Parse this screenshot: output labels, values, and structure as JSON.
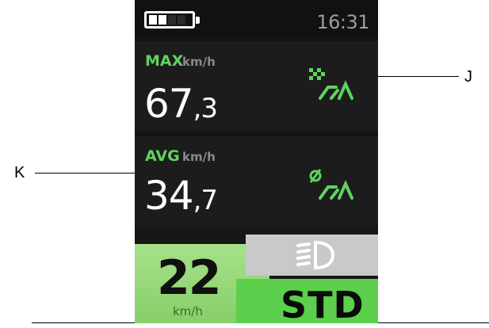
{
  "status": {
    "time": "16:31",
    "battery_icon": "battery-icon",
    "battery_level": 0.5
  },
  "max_panel": {
    "label": "MAX",
    "unit": "km/h",
    "value_int": "67",
    "value_dec": ",3",
    "icon": "max-speed-flag-icon"
  },
  "avg_panel": {
    "label": "AVG",
    "unit": "km/h",
    "value_int": "34",
    "value_dec": ",7",
    "icon": "avg-speed-icon"
  },
  "speed_tile": {
    "value": "22",
    "unit": "km/h"
  },
  "light_tile": {
    "icon": "headlight-icon"
  },
  "mode_tile": {
    "label": "STD"
  },
  "callouts": {
    "j": "J",
    "k": "K"
  },
  "colors": {
    "accent_green": "#5fd35f",
    "speed_tile": "#98d87a",
    "mode_tile": "#5ccf4c",
    "light_tile": "#c9c9c9"
  }
}
